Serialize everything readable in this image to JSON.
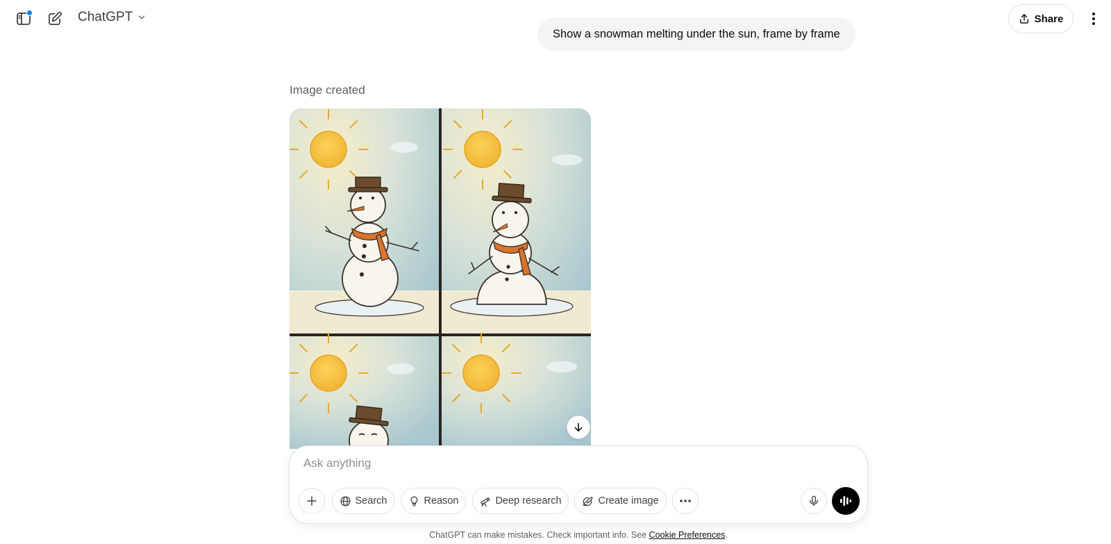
{
  "header": {
    "model_name": "ChatGPT",
    "share_label": "Share",
    "sidebar_icon": "sidebar-toggle-icon",
    "new_chat_icon": "compose-icon",
    "notification_color": "#0a84ff"
  },
  "conversation": {
    "user_message": "Show a snowman melting under the sun, frame by frame",
    "assistant": {
      "status": "Image created"
    }
  },
  "composer": {
    "placeholder": "Ask anything",
    "tools": {
      "search": "Search",
      "reason": "Reason",
      "deep_research": "Deep research",
      "create_image": "Create image"
    }
  },
  "footer": {
    "disclaimer": "ChatGPT can make mistakes. Check important info. See ",
    "link": "Cookie Preferences",
    "end": "."
  },
  "colors": {
    "accent": "#0a84ff",
    "bubble_bg": "#f4f4f4",
    "voice_button": "#000000"
  }
}
